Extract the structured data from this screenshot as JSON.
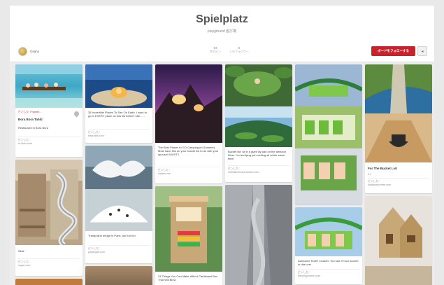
{
  "board": {
    "title": "Spielplatz",
    "description": "playground 遊び場",
    "owner_name": "Osaho",
    "stats": [
      {
        "num": "93",
        "label": "件のピン"
      },
      {
        "num": "6",
        "label": "人のフォロワー"
      }
    ],
    "follow_label": "ボードをフォローする",
    "send_icon": "send-icon"
  },
  "pins": [
    {
      "id": "bora",
      "title": "Bora Bora Tahiti",
      "meta": "ピンした: Fromhe...",
      "desc": "Restaurant in Bora Bora",
      "src_line1": "ピンした：",
      "src_line2": "m.flickr.com"
    },
    {
      "id": "places",
      "desc": "35 Incredible Places To See On Earth. I want to go to EVERY place on this list before I die......",
      "src_line1": "ピンした：",
      "src_line2": "enpundit.com"
    },
    {
      "id": "camping",
      "desc": "The Best Places to GO Camping (in Summer) Must have this on your bucket list to do with your spouse!! MUST!!",
      "src_line1": "ピンした：",
      "src_line2": "ohpine.me"
    },
    {
      "id": "lily",
      "desc": "Bucket list: sit in a giant lily pad on the amazon River. I'm terrifying yet exciting all at the same time!",
      "src_line1": "ピンした：",
      "src_line2": "reliefatthemind.tumblr.com"
    },
    {
      "id": "coaster1"
    },
    {
      "id": "bucket",
      "title": "For The Bucket List",
      "meta": "♥1",
      "src_line1": "ピンした：",
      "src_line2": "dailylivercenter.com"
    },
    {
      "id": "slide",
      "desc": "Slide",
      "src_line1": "ピンした：",
      "src_line2": "imgur.com"
    },
    {
      "id": "trampoline",
      "desc": "Trampoline bridge in Paris, fun fun fun",
      "src_line1": "ピンした：",
      "src_line2": "popsugar.com"
    },
    {
      "id": "cardboard",
      "desc": "31 Things You Can Make With A Cardboard Box That Will Blow"
    },
    {
      "id": "coaster2",
      "desc": "Awesome Roller Coaster. Too bad I'm too scared to ride one",
      "src_line1": "ピンした：",
      "src_line2": "thecoolpicture.com"
    },
    {
      "id": "house"
    }
  ]
}
